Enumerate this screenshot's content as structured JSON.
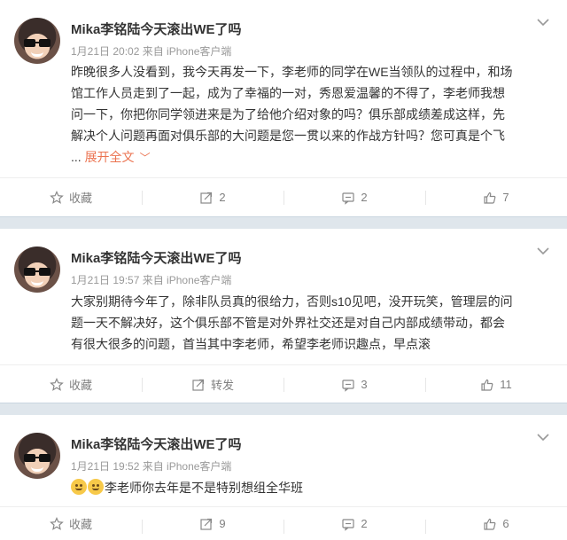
{
  "posts": [
    {
      "name": "Mika李铭陆今天滚出WE了吗",
      "meta": "1月21日 20:02 来自 iPhone客户端",
      "text_lines": [
        "昨晚很多人没看到，我今天再发一下，李老师的同学在WE当领队的过程中，和场",
        "馆工作人员走到了一起，成为了幸福的一对，秀恩爱温馨的不得了，李老师我想",
        "问一下，你把你同学领进来是为了给他介绍对象的吗？俱乐部成绩差成这样，先",
        "解决个人问题再面对俱乐部的大问题是您一贯以来的作战方针吗？您可真是个飞"
      ],
      "ellipsis": "...",
      "expand_label": "展开全文",
      "actions": {
        "fav": "收藏",
        "repost": "2",
        "comment": "2",
        "like": "7"
      }
    },
    {
      "name": "Mika李铭陆今天滚出WE了吗",
      "meta": "1月21日 19:57 来自 iPhone客户端",
      "text_lines": [
        "大家别期待今年了，除非队员真的很给力，否则s10见吧，没开玩笑，管理层的问",
        "题一天不解决好，这个俱乐部不管是对外界社交还是对自己内部成绩带动，都会",
        "有很大很多的问题，首当其中李老师，希望李老师识趣点，早点滚"
      ],
      "actions": {
        "fav": "收藏",
        "repost": "转发",
        "comment": "3",
        "like": "11"
      }
    },
    {
      "name": "Mika李铭陆今天滚出WE了吗",
      "meta": "1月21日 19:52 来自 iPhone客户端",
      "text": "李老师你去年是不是特别想组全华班",
      "actions": {
        "fav": "收藏",
        "repost": "9",
        "comment": "2",
        "like": "6"
      }
    }
  ],
  "icons": {
    "fav": "star-icon",
    "repost": "repost-icon",
    "comment": "comment-icon",
    "like": "thumbs-up-icon",
    "menu": "chevron-down-icon",
    "emoji": "smile-emoji-icon"
  },
  "colors": {
    "link": "#eb7350",
    "meta": "#999999",
    "separator": "#dfe6ec"
  }
}
